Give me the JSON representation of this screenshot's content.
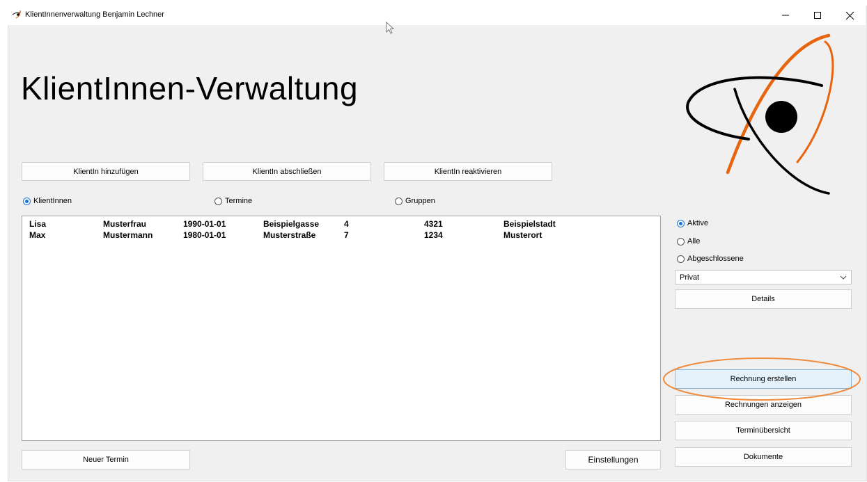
{
  "window": {
    "title": "KlientInnenverwaltung Benjamin Lechner"
  },
  "app": {
    "heading": "KlientInnen-Verwaltung"
  },
  "toolbar": {
    "add_client": "KlientIn hinzufügen",
    "close_client": "KlientIn abschließen",
    "reactivate_client": "KlientIn reaktivieren"
  },
  "view_mode": {
    "options": [
      "KlientInnen",
      "Termine",
      "Gruppen"
    ],
    "selected": "KlientInnen"
  },
  "clients": {
    "columns": [
      "first_name",
      "last_name",
      "birth_date",
      "street",
      "house_number",
      "postal_code",
      "city"
    ],
    "rows": [
      [
        "Lisa",
        "Musterfrau",
        "1990-01-01",
        "Beispielgasse",
        "4",
        "4321",
        "Beispielstadt"
      ],
      [
        "Max",
        "Mustermann",
        "1980-01-01",
        "Musterstraße",
        "7",
        "1234",
        "Musterort"
      ]
    ]
  },
  "filter": {
    "options": [
      "Aktive",
      "Alle",
      "Abgeschlossene"
    ],
    "selected": "Aktive"
  },
  "category_select": {
    "value": "Privat"
  },
  "side_actions": {
    "details": "Details",
    "create_invoice": "Rechnung erstellen",
    "show_invoices": "Rechnungen anzeigen",
    "appointments_overview": "Terminübersicht",
    "documents": "Dokumente"
  },
  "bottom_actions": {
    "new_appointment": "Neuer Termin",
    "settings": "Einstellungen"
  },
  "colors": {
    "logo_orange": "#e8650f",
    "highlight_oval": "#f08a3c",
    "radio_selected": "#1a73d8",
    "highlight_button": "#e5f1fb"
  }
}
